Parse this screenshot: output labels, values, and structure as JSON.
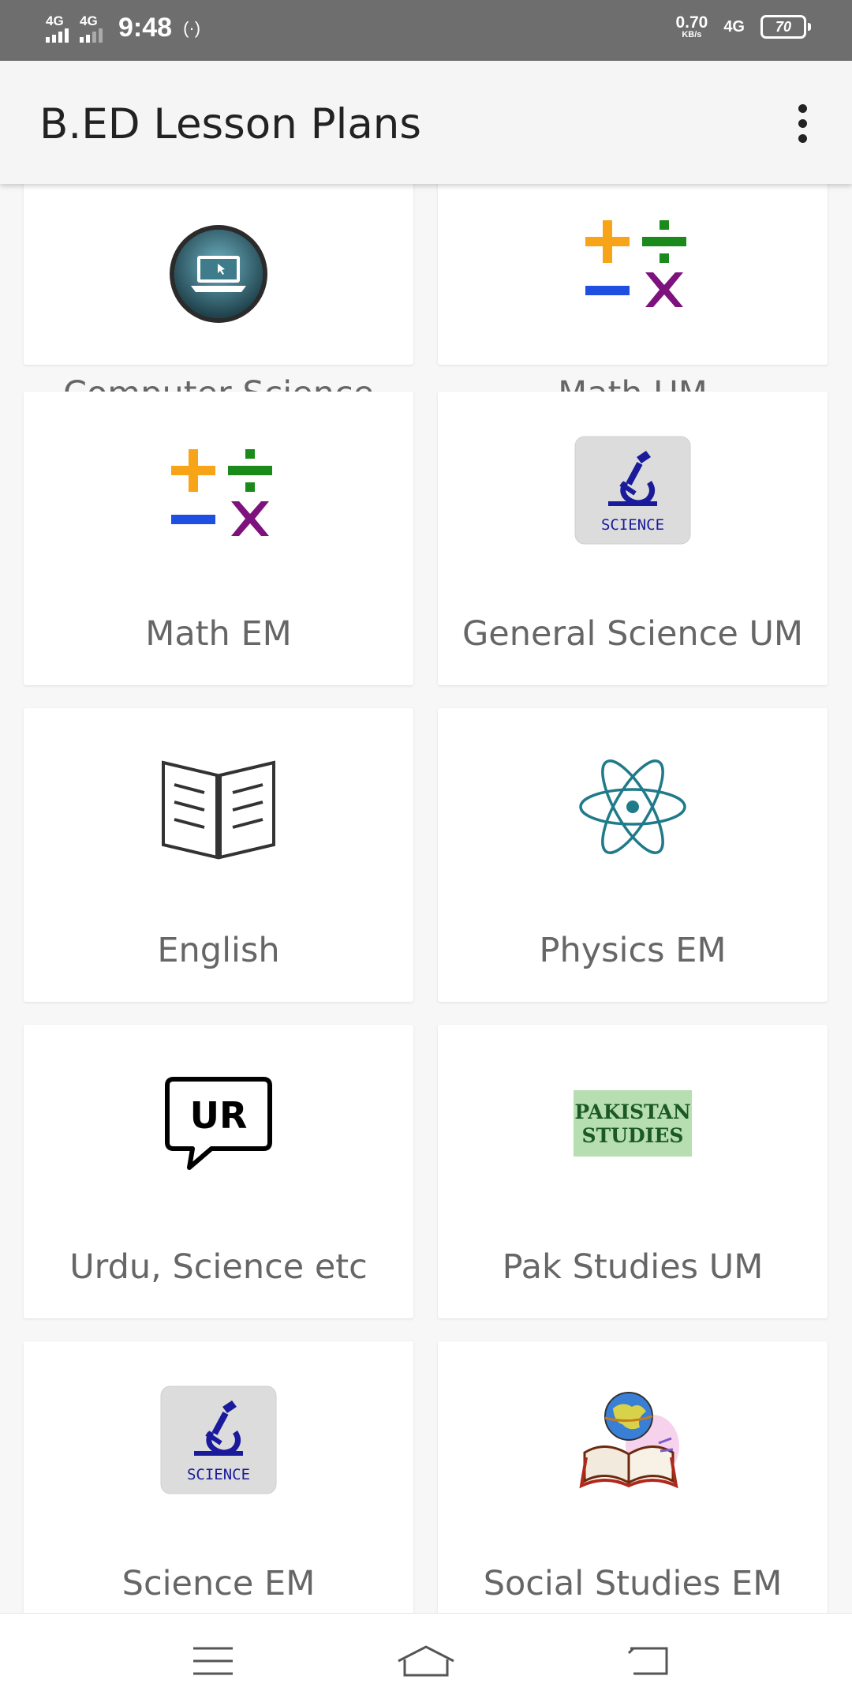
{
  "status_bar": {
    "signal1_label": "4G",
    "signal2_label": "4G",
    "time": "9:48",
    "hotspot": "(·)",
    "speed_value": "0.70",
    "speed_unit": "KB/s",
    "network": "4G",
    "battery": "70"
  },
  "app_bar": {
    "title": "B.ED Lesson Plans",
    "menu_icon": "more-vertical-icon"
  },
  "categories": [
    {
      "label": "Computer Science",
      "icon": "laptop-icon"
    },
    {
      "label": "Math UM",
      "icon": "math-symbols-icon"
    },
    {
      "label": "Math EM",
      "icon": "math-symbols-icon"
    },
    {
      "label": "General Science UM",
      "icon": "microscope-icon",
      "icon_text": "SCIENCE"
    },
    {
      "label": "English",
      "icon": "open-book-icon"
    },
    {
      "label": "Physics EM",
      "icon": "atom-icon"
    },
    {
      "label": "Urdu, Science etc",
      "icon": "speech-bubble-icon",
      "icon_text": "UR"
    },
    {
      "label": "Pak Studies UM",
      "icon": "pakistan-studies-icon",
      "icon_text": "PAKISTAN STUDIES",
      "icon_line1": "PAKISTAN",
      "icon_line2": "STUDIES"
    },
    {
      "label": "Science EM",
      "icon": "microscope-icon",
      "icon_text": "SCIENCE"
    },
    {
      "label": "Social Studies EM",
      "icon": "globe-book-icon"
    }
  ],
  "nav_bar": {
    "menu_icon": "hamburger-icon",
    "home_icon": "home-icon",
    "back_icon": "back-icon"
  }
}
